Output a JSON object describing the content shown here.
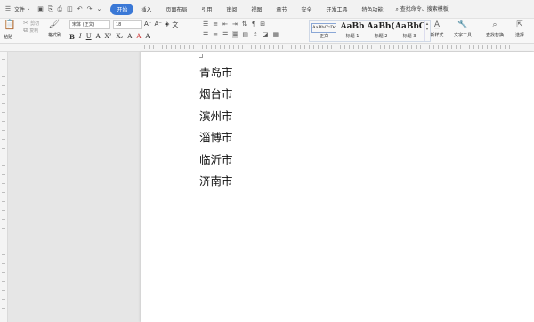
{
  "menubar": {
    "file_label": "文件",
    "tabs": [
      "开始",
      "插入",
      "页面布局",
      "引用",
      "审阅",
      "视图",
      "章节",
      "安全",
      "开发工具",
      "特色功能"
    ],
    "active_tab": "开始",
    "search_label": "查找命令、搜索模板"
  },
  "ribbon": {
    "paste": "粘贴",
    "format_painter": "格式刷",
    "font_name": "宋体 (正文)",
    "font_size": "18",
    "styles": [
      {
        "sample": "AaBbCcDd",
        "label": "正文"
      },
      {
        "sample": "AaBb",
        "label": "标题 1"
      },
      {
        "sample": "AaBb(",
        "label": "标题 2"
      },
      {
        "sample": "AaBbC(",
        "label": "标题 3"
      }
    ],
    "new_style": "新样式",
    "text_tools": "文字工具",
    "find_replace": "查找替换",
    "select": "选择"
  },
  "document": {
    "lines": [
      "青岛市",
      "烟台市",
      "滨州市",
      "淄博市",
      "临沂市",
      "济南市"
    ]
  },
  "colors": {
    "accent": "#3a78d6"
  }
}
